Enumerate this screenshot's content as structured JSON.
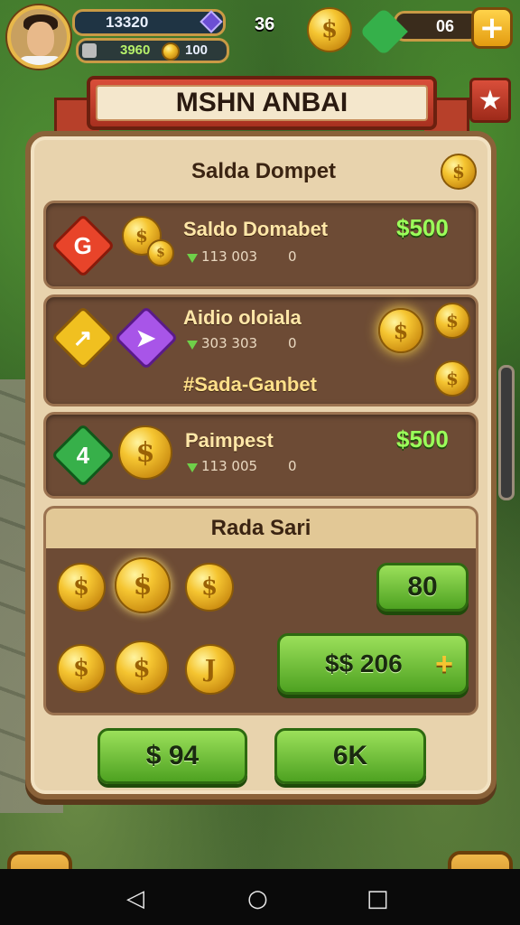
{
  "hud": {
    "xp": "13320",
    "coins_small": "3960",
    "coins_small_2": "100",
    "center_value": "36",
    "gems": "06",
    "coin_symbol": "$",
    "plus": "+"
  },
  "dialog": {
    "title": "MSHN ANBAI",
    "close_symbol": "★",
    "header_label": "Salda Dompet",
    "coin_symbol": "$"
  },
  "rows": [
    {
      "badge": "G",
      "name": "Saldo Domabet",
      "sub": "113 003",
      "zero": "0",
      "price": "$500",
      "badge_color": "#e8442a"
    },
    {
      "badge": "↗",
      "name": "Aidio oloiala",
      "sub": "303 303",
      "zero": "0",
      "price": "",
      "badge_color": "#f0c020",
      "badge2_color": "#a855e8"
    },
    {
      "badge": "4",
      "name": "Paimpest",
      "sub": "113 005",
      "zero": "0",
      "price": "$500",
      "badge_color": "#37b04a"
    }
  ],
  "extra_label": "#Sada-Ganbet",
  "section": {
    "title": "Rada Sari",
    "coin_symbol": "$",
    "coin_alt": "J",
    "value_btn": "80",
    "buy_btn": "$$ 206",
    "plus": "+"
  },
  "footer": {
    "btn1": "$ 94",
    "btn2": "6K"
  },
  "nav": {
    "back": "◁",
    "home": "○",
    "recent": "□"
  }
}
